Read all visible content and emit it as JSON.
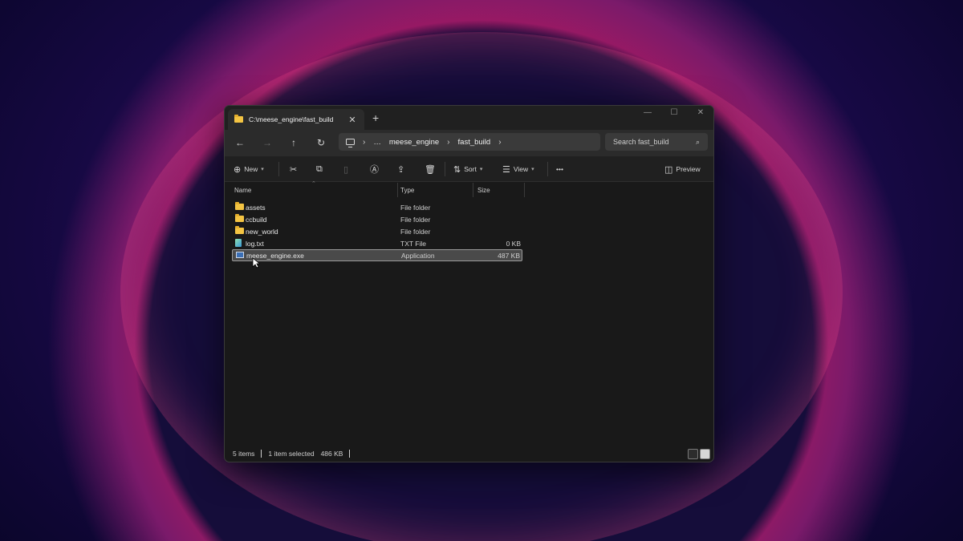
{
  "tab": {
    "title": "C:\\meese_engine\\fast_build",
    "close": "✕",
    "add": "+"
  },
  "window_controls": {
    "minimize": "—",
    "maximize": "☐",
    "close": "✕"
  },
  "nav": {
    "back": "←",
    "forward": "→",
    "up": "↑",
    "refresh": "↻",
    "breadcrumb": [
      "…",
      "meese_engine",
      "fast_build"
    ],
    "separator": "›",
    "search_placeholder": "Search fast_build"
  },
  "commands": {
    "new_label": "New",
    "sort_label": "Sort",
    "view_label": "View",
    "more": "•••",
    "preview_label": "Preview"
  },
  "columns": {
    "name": "Name",
    "type": "Type",
    "size": "Size"
  },
  "files": [
    {
      "name": "assets",
      "type": "File folder",
      "size": "",
      "icon": "folder-icon"
    },
    {
      "name": "ccbuild",
      "type": "File folder",
      "size": "",
      "icon": "folder-icon"
    },
    {
      "name": "new_world",
      "type": "File folder",
      "size": "",
      "icon": "folder-icon"
    },
    {
      "name": "log.txt",
      "type": "TXT File",
      "size": "0 KB",
      "icon": "text-file-icon"
    },
    {
      "name": "meese_engine.exe",
      "type": "Application",
      "size": "487 KB",
      "icon": "app-icon",
      "selected": true
    }
  ],
  "status": {
    "count": "5 items",
    "selection": "1 item selected",
    "sel_size": "486 KB"
  },
  "colors": {
    "accent_folder": "#f3c443",
    "window_bg": "#191919",
    "selection": "#4a4a4a"
  }
}
